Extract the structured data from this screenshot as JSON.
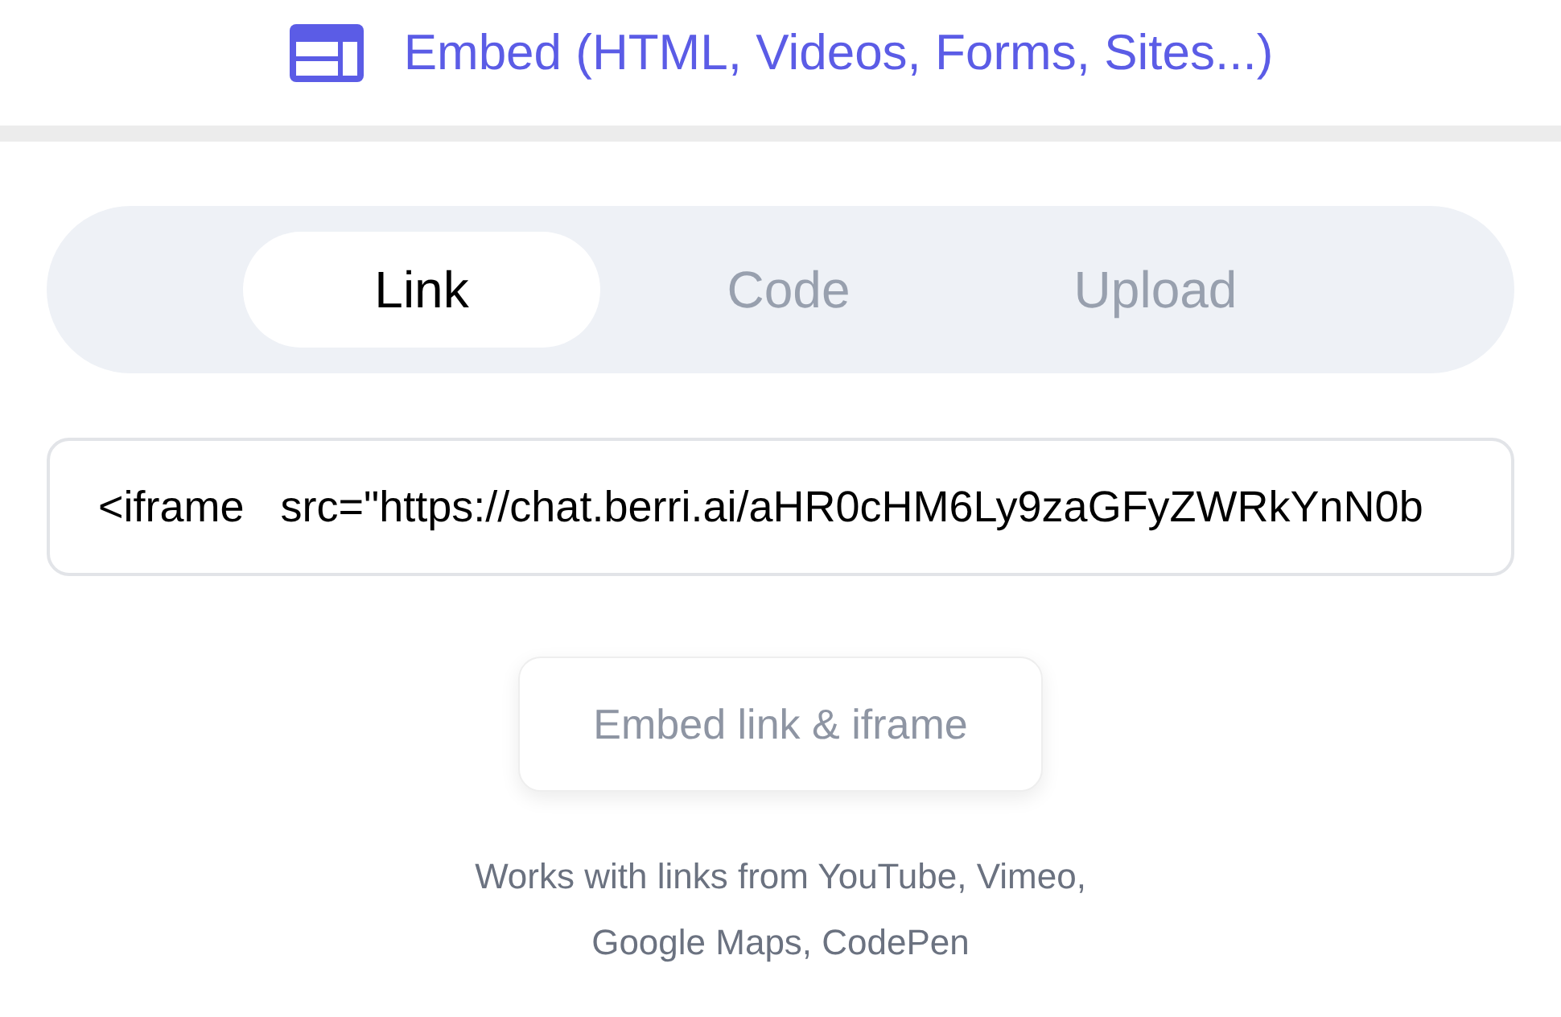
{
  "header": {
    "title": "Embed (HTML, Videos, Forms, Sites...)"
  },
  "tabs": [
    {
      "label": "Link",
      "selected": true
    },
    {
      "label": "Code",
      "selected": false
    },
    {
      "label": "Upload",
      "selected": false
    }
  ],
  "link_field": {
    "value": "<iframe   src=\"https://chat.berri.ai/aHR0cHM6Ly9zaGFyZWRkYnN0b"
  },
  "embed_button": {
    "label": "Embed link & iframe"
  },
  "help_text": [
    "Works with links from YouTube, Vimeo,",
    "Google Maps, CodePen"
  ]
}
